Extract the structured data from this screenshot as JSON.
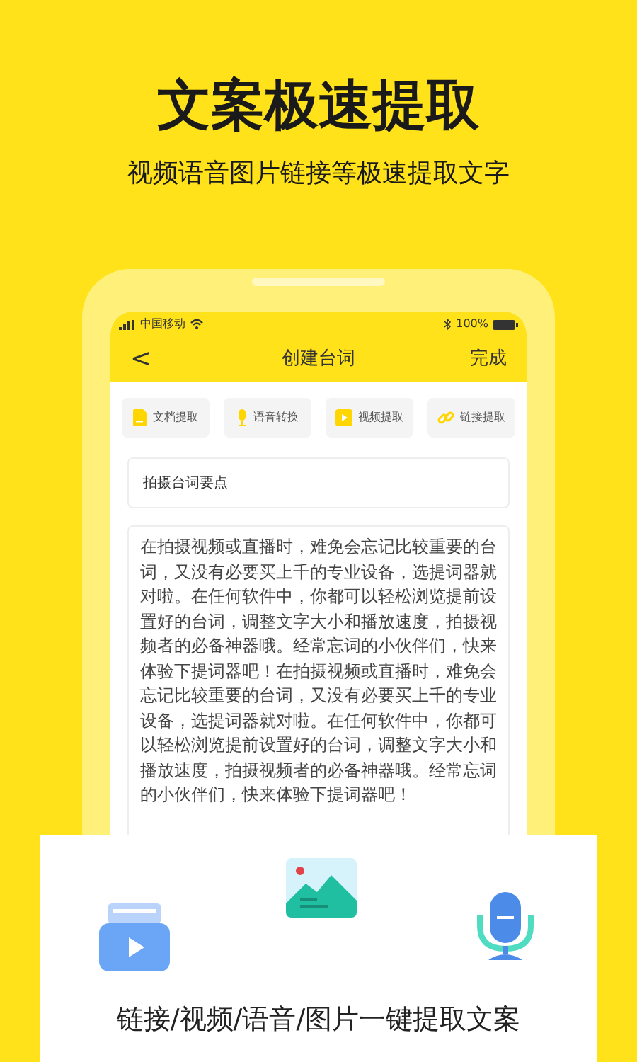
{
  "headline": "文案极速提取",
  "subtitle": "视频语音图片链接等极速提取文字",
  "status_bar": {
    "carrier": "中国移动",
    "battery": "100%"
  },
  "nav": {
    "back": "<",
    "title": "创建台词",
    "action": "完成"
  },
  "tools": [
    {
      "kind": "doc",
      "label": "文档提取"
    },
    {
      "kind": "mic",
      "label": "语音转换"
    },
    {
      "kind": "video",
      "label": "视频提取"
    },
    {
      "kind": "link",
      "label": "链接提取"
    }
  ],
  "topic_field": {
    "value": "拍摄台词要点"
  },
  "script_text": "在拍摄视频或直播时，难免会忘记比较重要的台词，又没有必要买上千的专业设备，选提词器就对啦。在任何软件中，你都可以轻松浏览提前设置好的台词，调整文字大小和播放速度，拍摄视频者的必备神器哦。经常忘词的小伙伴们，快来体验下提词器吧！在拍摄视频或直播时，难免会忘记比较重要的台词，又没有必要买上千的专业设备，选提词器就对啦。在任何软件中，你都可以轻松浏览提前设置好的台词，调整文字大小和播放速度，拍摄视频者的必备神器哦。经常忘词的小伙伴们，快来体验下提词器吧！",
  "caption": "链接/视频/语音/图片一键提取文案"
}
